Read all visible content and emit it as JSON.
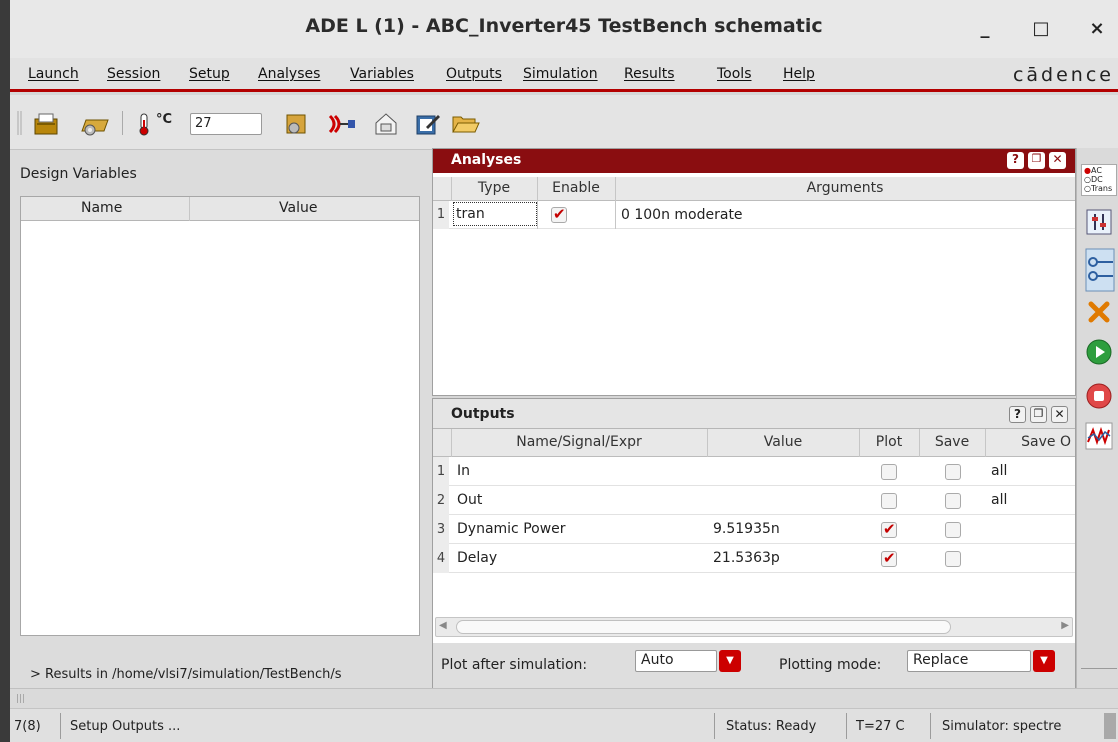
{
  "window": {
    "title": "ADE L (1) - ABC_Inverter45 TestBench schematic",
    "minimize_label": "_",
    "maximize_label": "□",
    "close_label": "×"
  },
  "menubar": {
    "items": [
      "Launch",
      "Session",
      "Setup",
      "Analyses",
      "Variables",
      "Outputs",
      "Simulation",
      "Results",
      "Tools",
      "Help"
    ],
    "brand": "cādence"
  },
  "toolbar": {
    "temperature_unit": "°C",
    "temperature_value": "27"
  },
  "design_variables": {
    "title": "Design Variables",
    "columns": [
      "Name",
      "Value"
    ],
    "results_path": "> Results in /home/vlsi7/simulation/TestBench/s"
  },
  "analyses": {
    "title": "Analyses",
    "columns": [
      "Type",
      "Enable",
      "Arguments"
    ],
    "rows": [
      {
        "num": "1",
        "type": "tran",
        "enabled": true,
        "arguments": "0 100n moderate"
      }
    ]
  },
  "outputs": {
    "title": "Outputs",
    "columns": [
      "Name/Signal/Expr",
      "Value",
      "Plot",
      "Save",
      "Save O"
    ],
    "rows": [
      {
        "num": "1",
        "name": "In",
        "value": "",
        "plot": false,
        "save": false,
        "save_opt": "all"
      },
      {
        "num": "2",
        "name": "Out",
        "value": "",
        "plot": false,
        "save": false,
        "save_opt": "all"
      },
      {
        "num": "3",
        "name": "Dynamic Power",
        "value": "9.51935n",
        "plot": true,
        "save": false,
        "save_opt": ""
      },
      {
        "num": "4",
        "name": "Delay",
        "value": "21.5363p",
        "plot": true,
        "save": false,
        "save_opt": ""
      }
    ],
    "plot_after_label": "Plot after simulation:",
    "plot_after_value": "Auto",
    "plotting_mode_label": "Plotting mode:",
    "plotting_mode_value": "Replace"
  },
  "side_toolbar": {
    "radio_options": [
      "AC",
      "DC",
      "Trans"
    ],
    "selected": "AC"
  },
  "statusbar": {
    "counter": "7(8)",
    "message": "Setup Outputs ...",
    "status": "Status: Ready",
    "temperature": "T=27 C",
    "simulator": "Simulator: spectre"
  },
  "colors": {
    "accent": "#8a0d10",
    "check": "#c40000",
    "run_green": "#2e9e3e"
  }
}
